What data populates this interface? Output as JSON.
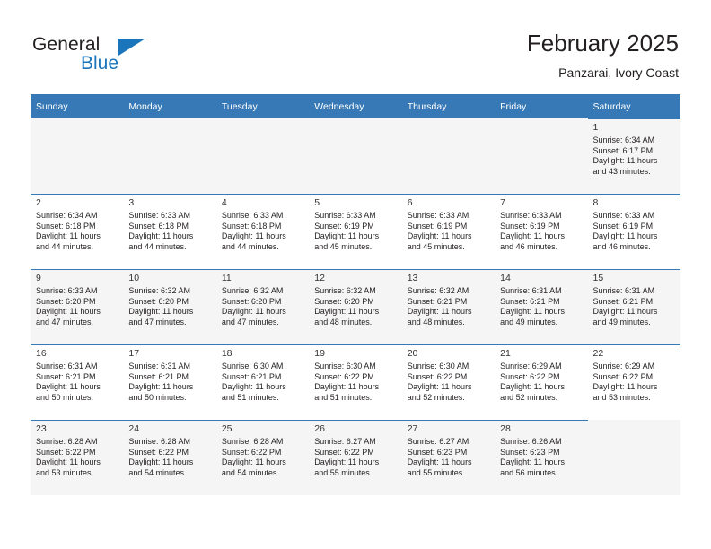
{
  "brand": {
    "name_part1": "General",
    "name_part2": "Blue",
    "accent_color": "#1b75bb"
  },
  "header": {
    "title": "February 2025",
    "subtitle": "Panzarai, Ivory Coast"
  },
  "calendar": {
    "header_color": "#3679b6",
    "weekday_headers": [
      "Sunday",
      "Monday",
      "Tuesday",
      "Wednesday",
      "Thursday",
      "Friday",
      "Saturday"
    ],
    "weeks": [
      [
        {
          "day": "",
          "sunrise": "",
          "sunset": "",
          "daylight1": "",
          "daylight2": ""
        },
        {
          "day": "",
          "sunrise": "",
          "sunset": "",
          "daylight1": "",
          "daylight2": ""
        },
        {
          "day": "",
          "sunrise": "",
          "sunset": "",
          "daylight1": "",
          "daylight2": ""
        },
        {
          "day": "",
          "sunrise": "",
          "sunset": "",
          "daylight1": "",
          "daylight2": ""
        },
        {
          "day": "",
          "sunrise": "",
          "sunset": "",
          "daylight1": "",
          "daylight2": ""
        },
        {
          "day": "",
          "sunrise": "",
          "sunset": "",
          "daylight1": "",
          "daylight2": ""
        },
        {
          "day": "1",
          "sunrise": "Sunrise: 6:34 AM",
          "sunset": "Sunset: 6:17 PM",
          "daylight1": "Daylight: 11 hours",
          "daylight2": "and 43 minutes."
        }
      ],
      [
        {
          "day": "2",
          "sunrise": "Sunrise: 6:34 AM",
          "sunset": "Sunset: 6:18 PM",
          "daylight1": "Daylight: 11 hours",
          "daylight2": "and 44 minutes."
        },
        {
          "day": "3",
          "sunrise": "Sunrise: 6:33 AM",
          "sunset": "Sunset: 6:18 PM",
          "daylight1": "Daylight: 11 hours",
          "daylight2": "and 44 minutes."
        },
        {
          "day": "4",
          "sunrise": "Sunrise: 6:33 AM",
          "sunset": "Sunset: 6:18 PM",
          "daylight1": "Daylight: 11 hours",
          "daylight2": "and 44 minutes."
        },
        {
          "day": "5",
          "sunrise": "Sunrise: 6:33 AM",
          "sunset": "Sunset: 6:19 PM",
          "daylight1": "Daylight: 11 hours",
          "daylight2": "and 45 minutes."
        },
        {
          "day": "6",
          "sunrise": "Sunrise: 6:33 AM",
          "sunset": "Sunset: 6:19 PM",
          "daylight1": "Daylight: 11 hours",
          "daylight2": "and 45 minutes."
        },
        {
          "day": "7",
          "sunrise": "Sunrise: 6:33 AM",
          "sunset": "Sunset: 6:19 PM",
          "daylight1": "Daylight: 11 hours",
          "daylight2": "and 46 minutes."
        },
        {
          "day": "8",
          "sunrise": "Sunrise: 6:33 AM",
          "sunset": "Sunset: 6:19 PM",
          "daylight1": "Daylight: 11 hours",
          "daylight2": "and 46 minutes."
        }
      ],
      [
        {
          "day": "9",
          "sunrise": "Sunrise: 6:33 AM",
          "sunset": "Sunset: 6:20 PM",
          "daylight1": "Daylight: 11 hours",
          "daylight2": "and 47 minutes."
        },
        {
          "day": "10",
          "sunrise": "Sunrise: 6:32 AM",
          "sunset": "Sunset: 6:20 PM",
          "daylight1": "Daylight: 11 hours",
          "daylight2": "and 47 minutes."
        },
        {
          "day": "11",
          "sunrise": "Sunrise: 6:32 AM",
          "sunset": "Sunset: 6:20 PM",
          "daylight1": "Daylight: 11 hours",
          "daylight2": "and 47 minutes."
        },
        {
          "day": "12",
          "sunrise": "Sunrise: 6:32 AM",
          "sunset": "Sunset: 6:20 PM",
          "daylight1": "Daylight: 11 hours",
          "daylight2": "and 48 minutes."
        },
        {
          "day": "13",
          "sunrise": "Sunrise: 6:32 AM",
          "sunset": "Sunset: 6:21 PM",
          "daylight1": "Daylight: 11 hours",
          "daylight2": "and 48 minutes."
        },
        {
          "day": "14",
          "sunrise": "Sunrise: 6:31 AM",
          "sunset": "Sunset: 6:21 PM",
          "daylight1": "Daylight: 11 hours",
          "daylight2": "and 49 minutes."
        },
        {
          "day": "15",
          "sunrise": "Sunrise: 6:31 AM",
          "sunset": "Sunset: 6:21 PM",
          "daylight1": "Daylight: 11 hours",
          "daylight2": "and 49 minutes."
        }
      ],
      [
        {
          "day": "16",
          "sunrise": "Sunrise: 6:31 AM",
          "sunset": "Sunset: 6:21 PM",
          "daylight1": "Daylight: 11 hours",
          "daylight2": "and 50 minutes."
        },
        {
          "day": "17",
          "sunrise": "Sunrise: 6:31 AM",
          "sunset": "Sunset: 6:21 PM",
          "daylight1": "Daylight: 11 hours",
          "daylight2": "and 50 minutes."
        },
        {
          "day": "18",
          "sunrise": "Sunrise: 6:30 AM",
          "sunset": "Sunset: 6:21 PM",
          "daylight1": "Daylight: 11 hours",
          "daylight2": "and 51 minutes."
        },
        {
          "day": "19",
          "sunrise": "Sunrise: 6:30 AM",
          "sunset": "Sunset: 6:22 PM",
          "daylight1": "Daylight: 11 hours",
          "daylight2": "and 51 minutes."
        },
        {
          "day": "20",
          "sunrise": "Sunrise: 6:30 AM",
          "sunset": "Sunset: 6:22 PM",
          "daylight1": "Daylight: 11 hours",
          "daylight2": "and 52 minutes."
        },
        {
          "day": "21",
          "sunrise": "Sunrise: 6:29 AM",
          "sunset": "Sunset: 6:22 PM",
          "daylight1": "Daylight: 11 hours",
          "daylight2": "and 52 minutes."
        },
        {
          "day": "22",
          "sunrise": "Sunrise: 6:29 AM",
          "sunset": "Sunset: 6:22 PM",
          "daylight1": "Daylight: 11 hours",
          "daylight2": "and 53 minutes."
        }
      ],
      [
        {
          "day": "23",
          "sunrise": "Sunrise: 6:28 AM",
          "sunset": "Sunset: 6:22 PM",
          "daylight1": "Daylight: 11 hours",
          "daylight2": "and 53 minutes."
        },
        {
          "day": "24",
          "sunrise": "Sunrise: 6:28 AM",
          "sunset": "Sunset: 6:22 PM",
          "daylight1": "Daylight: 11 hours",
          "daylight2": "and 54 minutes."
        },
        {
          "day": "25",
          "sunrise": "Sunrise: 6:28 AM",
          "sunset": "Sunset: 6:22 PM",
          "daylight1": "Daylight: 11 hours",
          "daylight2": "and 54 minutes."
        },
        {
          "day": "26",
          "sunrise": "Sunrise: 6:27 AM",
          "sunset": "Sunset: 6:22 PM",
          "daylight1": "Daylight: 11 hours",
          "daylight2": "and 55 minutes."
        },
        {
          "day": "27",
          "sunrise": "Sunrise: 6:27 AM",
          "sunset": "Sunset: 6:23 PM",
          "daylight1": "Daylight: 11 hours",
          "daylight2": "and 55 minutes."
        },
        {
          "day": "28",
          "sunrise": "Sunrise: 6:26 AM",
          "sunset": "Sunset: 6:23 PM",
          "daylight1": "Daylight: 11 hours",
          "daylight2": "and 56 minutes."
        },
        {
          "day": "",
          "sunrise": "",
          "sunset": "",
          "daylight1": "",
          "daylight2": ""
        }
      ]
    ]
  }
}
